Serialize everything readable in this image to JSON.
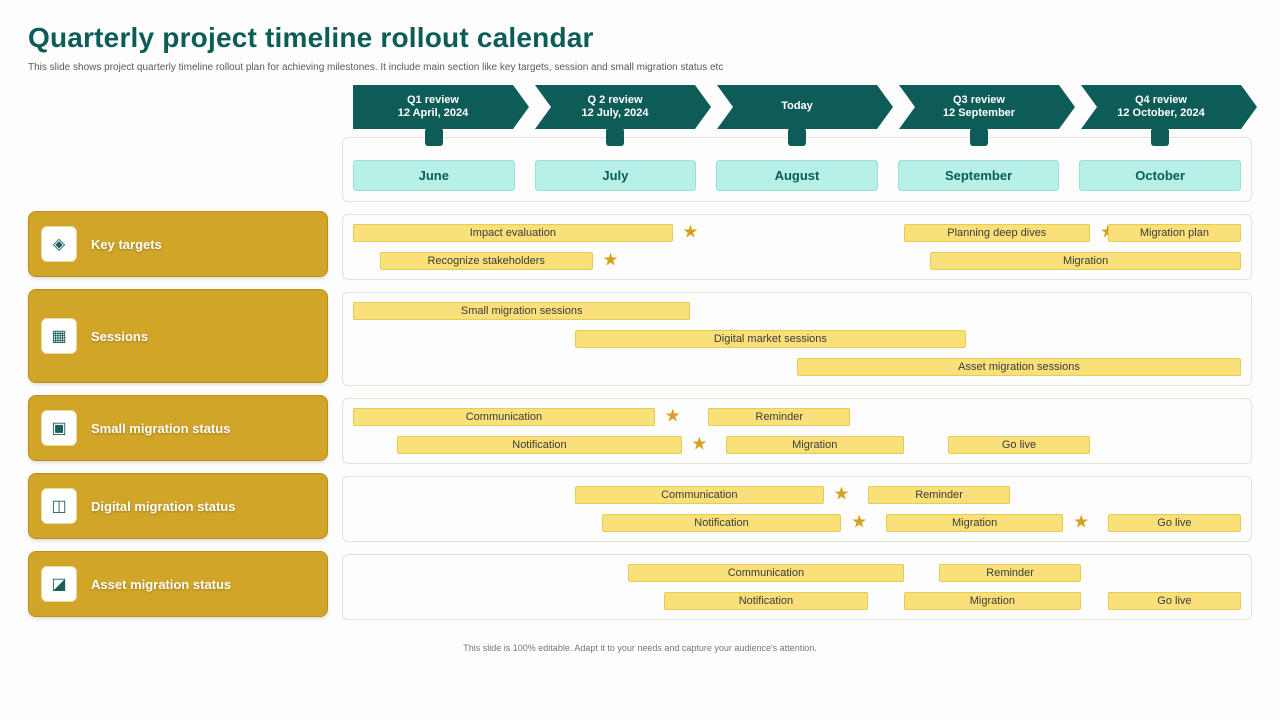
{
  "title": "Quarterly project timeline rollout calendar",
  "subtitle": "This slide shows project quarterly timeline rollout plan for achieving milestones. It include main section like key targets, session and small migration status etc",
  "footer": "This slide is 100% editable. Adapt it to your needs and capture your audience's attention.",
  "milestones": [
    {
      "l1": "Q1 review",
      "l2": "12 April, 2024"
    },
    {
      "l1": "Q 2 review",
      "l2": "12 July, 2024"
    },
    {
      "l1": "Today",
      "l2": ""
    },
    {
      "l1": "Q3 review",
      "l2": "12 September"
    },
    {
      "l1": "Q4 review",
      "l2": "12 October, 2024"
    }
  ],
  "months": [
    "June",
    "July",
    "August",
    "September",
    "October"
  ],
  "categories": [
    {
      "label": "Key targets",
      "icon": "target-icon",
      "glyph": "◈"
    },
    {
      "label": "Sessions",
      "icon": "sessions-icon",
      "glyph": "▦"
    },
    {
      "label": "Small migration status",
      "icon": "status-icon",
      "glyph": "▣"
    },
    {
      "label": "Digital migration status",
      "icon": "digital-icon",
      "glyph": "◫"
    },
    {
      "label": "Asset migration status",
      "icon": "asset-icon",
      "glyph": "◪"
    }
  ],
  "chart_data": {
    "type": "gantt",
    "x_domain": {
      "min": 0,
      "max": 100,
      "unit": "percent-of-timeline",
      "months": [
        "June",
        "July",
        "August",
        "September",
        "October"
      ]
    },
    "lanes": [
      {
        "name": "Key targets",
        "rows": [
          {
            "bars": [
              {
                "label": "Impact evaluation",
                "start": 0,
                "end": 36,
                "star_after": true
              },
              {
                "label": "Planning deep dives",
                "start": 62,
                "end": 83,
                "star_after": true
              },
              {
                "label": "Migration plan",
                "start": 85,
                "end": 100
              }
            ]
          },
          {
            "bars": [
              {
                "label": "Recognize stakeholders",
                "start": 3,
                "end": 27,
                "star_after": true
              },
              {
                "label": "Migration",
                "start": 65,
                "end": 100
              }
            ]
          }
        ]
      },
      {
        "name": "Sessions",
        "rows": [
          {
            "bars": [
              {
                "label": "Small migration sessions",
                "start": 0,
                "end": 38
              }
            ]
          },
          {
            "bars": [
              {
                "label": "Digital market sessions",
                "start": 25,
                "end": 69
              }
            ]
          },
          {
            "bars": [
              {
                "label": "Asset migration sessions",
                "start": 50,
                "end": 100
              }
            ]
          }
        ]
      },
      {
        "name": "Small migration status",
        "rows": [
          {
            "bars": [
              {
                "label": "Communication",
                "start": 0,
                "end": 34,
                "star_after": true
              },
              {
                "label": "Reminder",
                "start": 40,
                "end": 56
              }
            ]
          },
          {
            "bars": [
              {
                "label": "Notification",
                "start": 5,
                "end": 37,
                "star_after": true
              },
              {
                "label": "Migration",
                "start": 42,
                "end": 62
              },
              {
                "label": "Go live",
                "start": 67,
                "end": 83
              }
            ]
          }
        ]
      },
      {
        "name": "Digital migration status",
        "rows": [
          {
            "bars": [
              {
                "label": "Communication",
                "start": 25,
                "end": 53,
                "star_after": true
              },
              {
                "label": "Reminder",
                "start": 58,
                "end": 74
              }
            ]
          },
          {
            "bars": [
              {
                "label": "Notification",
                "start": 28,
                "end": 55,
                "star_after": true
              },
              {
                "label": "Migration",
                "start": 60,
                "end": 80,
                "star_after": true
              },
              {
                "label": "Go live",
                "start": 85,
                "end": 100
              }
            ]
          }
        ]
      },
      {
        "name": "Asset migration status",
        "rows": [
          {
            "bars": [
              {
                "label": "Communication",
                "start": 31,
                "end": 62
              },
              {
                "label": "Reminder",
                "start": 66,
                "end": 82
              }
            ]
          },
          {
            "bars": [
              {
                "label": "Notification",
                "start": 35,
                "end": 58
              },
              {
                "label": "Migration",
                "start": 62,
                "end": 82
              },
              {
                "label": "Go live",
                "start": 85,
                "end": 100
              }
            ]
          }
        ]
      }
    ]
  }
}
